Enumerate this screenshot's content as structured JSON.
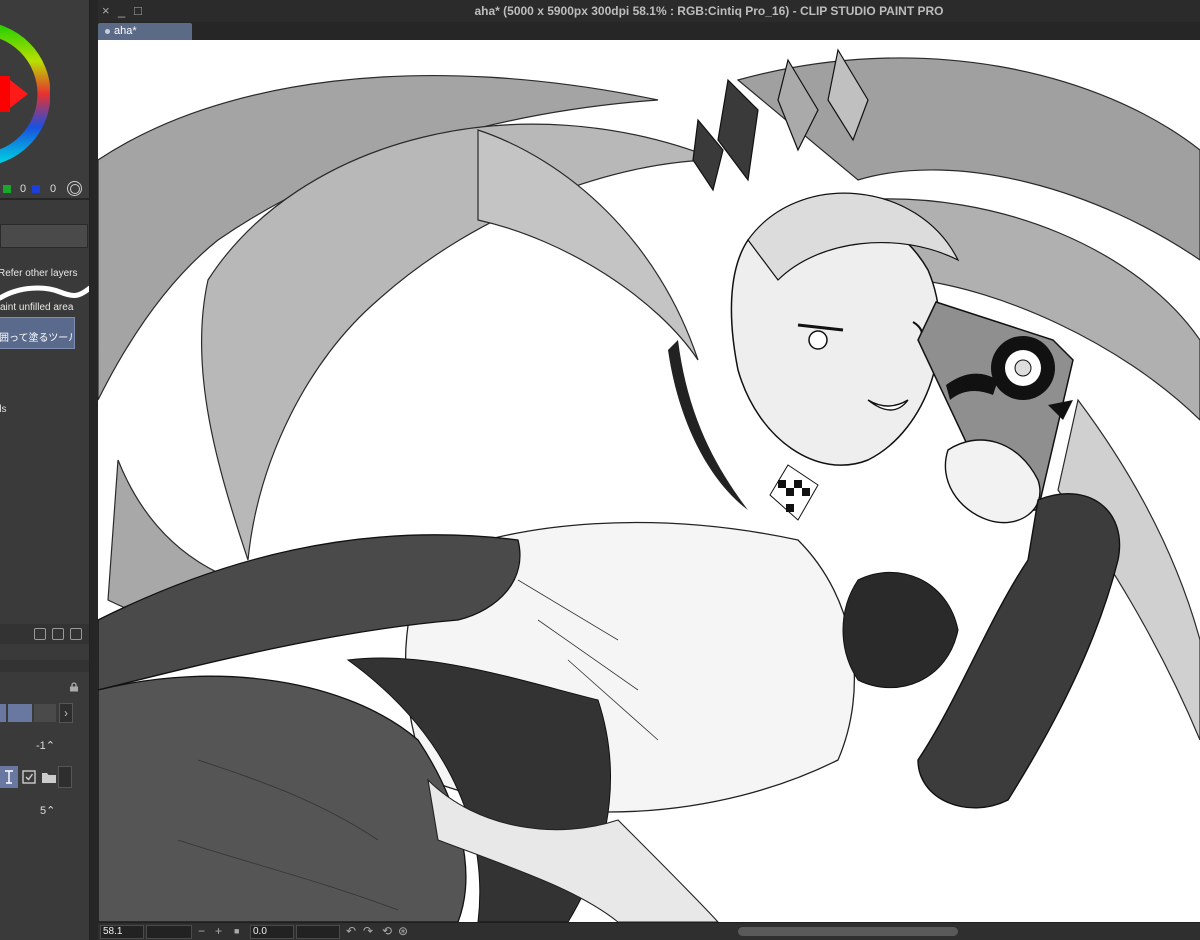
{
  "window": {
    "title": "aha* (5000 x 5900px 300dpi 58.1% : RGB:Cintiq Pro_16)  - CLIP STUDIO PAINT PRO",
    "controls": {
      "close": "×",
      "minimize": "_",
      "maximize": "□"
    }
  },
  "tabs": [
    {
      "label": "aha*",
      "active": true
    }
  ],
  "color_panel": {
    "green_value": "0",
    "blue_value": "0",
    "colors": {
      "green": "#1aa82a",
      "blue": "#1b3fd8",
      "current_color": "#ff0000"
    }
  },
  "tool_panel": {
    "refer_other_layers": "Refer other layers",
    "paint_unfilled_area": "aint unfilled area",
    "selected_tool": "囲って塗るツール",
    "property_fragment": "ds"
  },
  "layer_panel": {
    "value_top": "-1",
    "value_bottom": "5"
  },
  "status_bar": {
    "zoom": "58.1",
    "angle": "0.0",
    "zoom_out": "−",
    "zoom_in": "+",
    "rotate_left": "↶",
    "rotate_right": "↷",
    "reset": "⟲"
  },
  "colors": {
    "ui_background": "#2b2b2b",
    "panel": "#3a3a3a",
    "tab_active": "#5b6a86",
    "canvas": "#ffffff"
  }
}
